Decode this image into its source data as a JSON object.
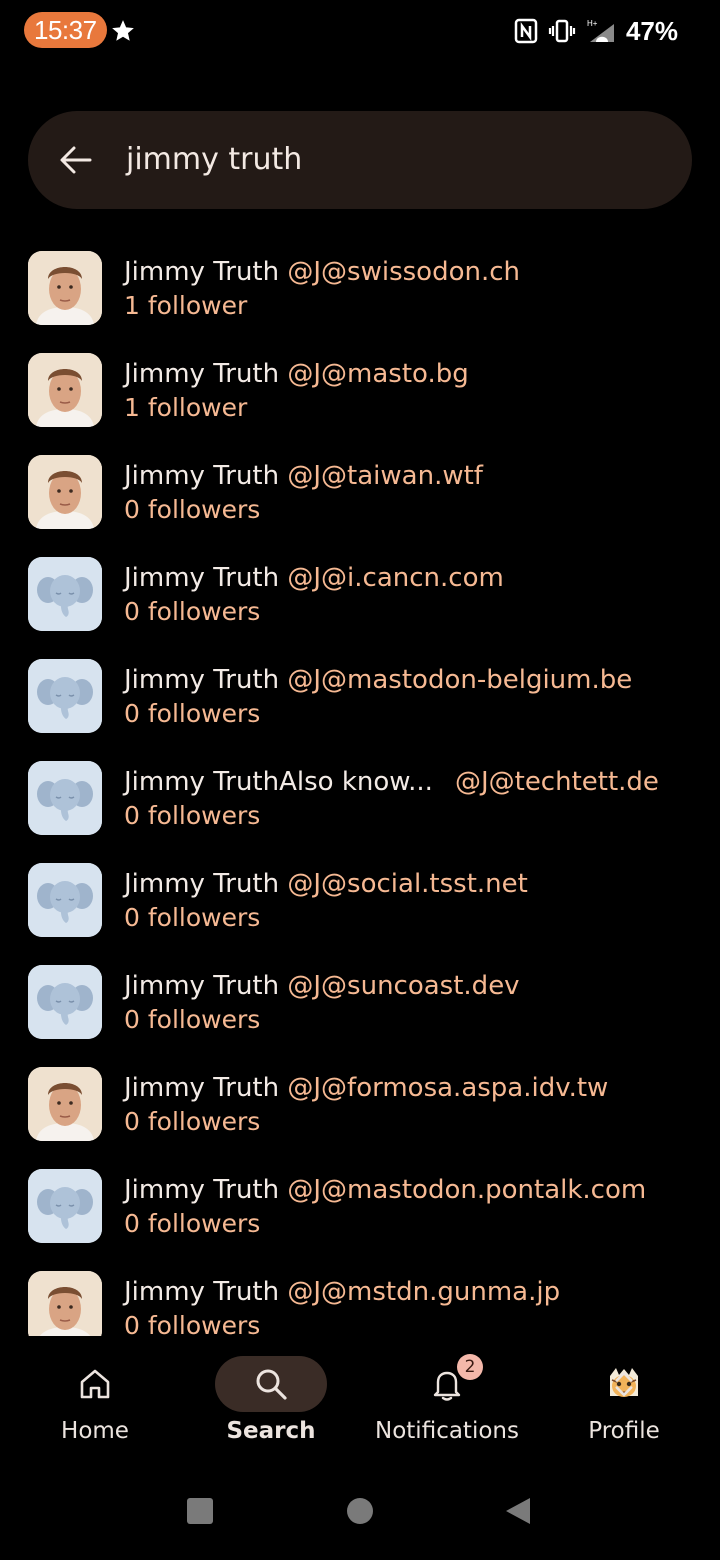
{
  "status_bar": {
    "time": "15:37",
    "battery": "47%",
    "icons": [
      "star-icon",
      "nfc-icon",
      "vibrate-icon",
      "signal-icon",
      "battery-text"
    ]
  },
  "search": {
    "query": "jimmy truth",
    "back_icon": "arrow-left-icon"
  },
  "results": [
    {
      "name": "Jimmy Truth",
      "handle": "@J@swissodon.ch",
      "followers": "1 follower",
      "avatar": "photo"
    },
    {
      "name": "Jimmy Truth",
      "handle": "@J@masto.bg",
      "followers": "1 follower",
      "avatar": "photo"
    },
    {
      "name": "Jimmy Truth",
      "handle": "@J@taiwan.wtf",
      "followers": "0 followers",
      "avatar": "photo"
    },
    {
      "name": "Jimmy Truth",
      "handle": "@J@i.cancn.com",
      "followers": "0 followers",
      "avatar": "default"
    },
    {
      "name": "Jimmy Truth",
      "handle": "@J@mastodon-belgium.be",
      "followers": "0 followers",
      "avatar": "default"
    },
    {
      "name": "Jimmy TruthAlso know...",
      "handle": "@J@techtett.de",
      "followers": "0 followers",
      "avatar": "default"
    },
    {
      "name": "Jimmy Truth",
      "handle": "@J@social.tsst.net",
      "followers": "0 followers",
      "avatar": "default"
    },
    {
      "name": "Jimmy Truth",
      "handle": "@J@suncoast.dev",
      "followers": "0 followers",
      "avatar": "default"
    },
    {
      "name": "Jimmy Truth",
      "handle": "@J@formosa.aspa.idv.tw",
      "followers": "0 followers",
      "avatar": "photo"
    },
    {
      "name": "Jimmy Truth",
      "handle": "@J@mastodon.pontalk.com",
      "followers": "0 followers",
      "avatar": "default"
    },
    {
      "name": "Jimmy Truth",
      "handle": "@J@mstdn.gunma.jp",
      "followers": "0 followers",
      "avatar": "photo"
    }
  ],
  "bottom_nav": {
    "home": "Home",
    "search": "Search",
    "notifications": "Notifications",
    "notifications_badge": "2",
    "profile": "Profile",
    "active": "search"
  },
  "colors": {
    "accent": "#f6b993",
    "time_pill": "#e8783c",
    "search_bg": "#231a16",
    "active_nav_bg": "#3a2c26"
  }
}
